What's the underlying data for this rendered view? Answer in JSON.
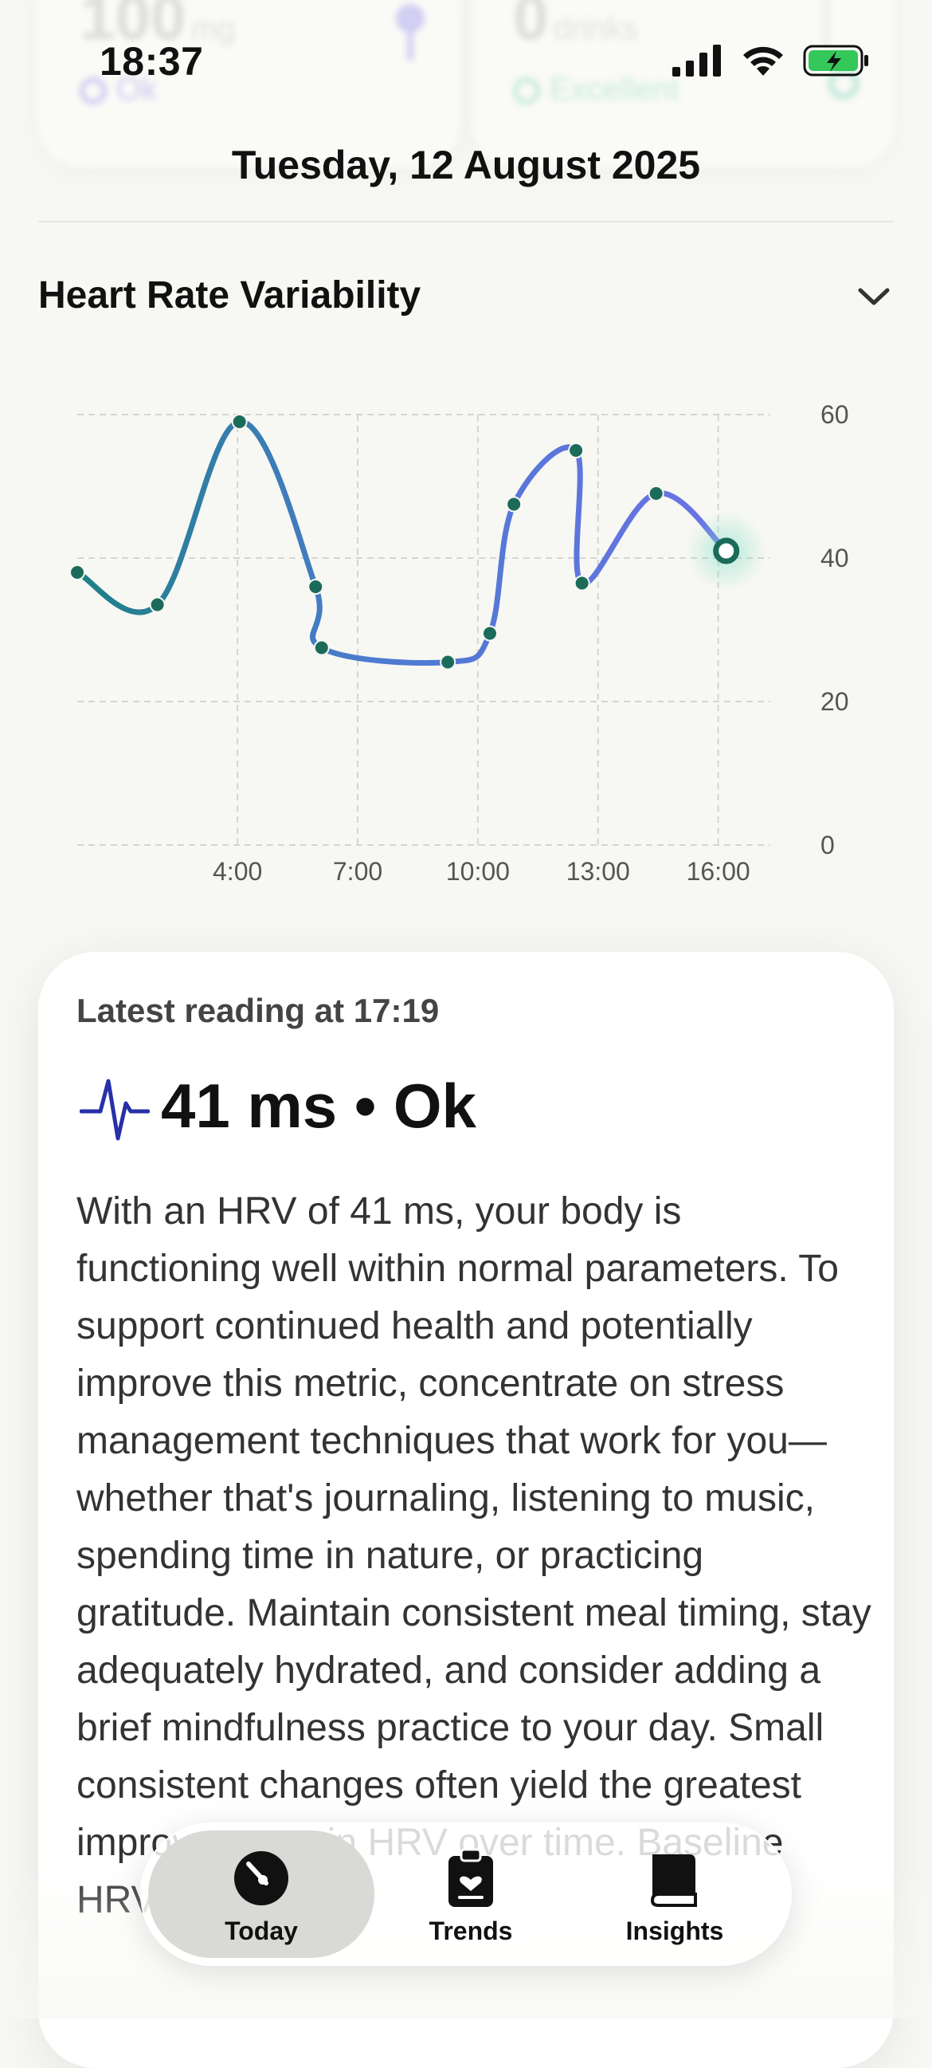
{
  "ghost_cards": [
    {
      "value": "100",
      "unit": "mg",
      "status": "Ok"
    },
    {
      "value": "0",
      "unit": "drinks",
      "status": "Excellent"
    }
  ],
  "status_bar": {
    "time": "18:37",
    "icons": [
      "cellular-signal-icon",
      "wifi-icon",
      "battery-charging-icon"
    ],
    "battery_color": "#34c759"
  },
  "header": {
    "date": "Tuesday, 12 August 2025"
  },
  "section": {
    "title": "Heart Rate Variability",
    "toggle_icon": "chevron-down-icon"
  },
  "chart_data": {
    "type": "line",
    "x_tick_labels": [
      "4:00",
      "7:00",
      "10:00",
      "13:00",
      "16:00"
    ],
    "x_ticks_hours": [
      4,
      7,
      10,
      13,
      16
    ],
    "xlim_hours": [
      0,
      17.3
    ],
    "ylim": [
      0,
      60
    ],
    "y_ticks": [
      0,
      20,
      40,
      60
    ],
    "grid": true,
    "y_axis_side": "right",
    "series": [
      {
        "points": [
          {
            "x": 0.0,
            "y": 38
          },
          {
            "x": 2.0,
            "y": 33.5
          },
          {
            "x": 4.05,
            "y": 59
          },
          {
            "x": 5.95,
            "y": 36
          },
          {
            "x": 6.1,
            "y": 27.5
          },
          {
            "x": 9.25,
            "y": 25.5
          },
          {
            "x": 10.3,
            "y": 29.5
          },
          {
            "x": 10.9,
            "y": 47.5
          },
          {
            "x": 12.45,
            "y": 55
          },
          {
            "x": 12.6,
            "y": 36.5
          },
          {
            "x": 14.45,
            "y": 49
          },
          {
            "x": 16.2,
            "y": 41
          }
        ]
      }
    ],
    "colors": {
      "start": "#1e7f86",
      "end": "#6a72e6",
      "point": "#1b6b5a",
      "latest_glow": "#7fe0c4"
    }
  },
  "reading": {
    "latest_label": "Latest reading at 17:19",
    "icon": "heart-pulse-icon",
    "value_text": "41 ms • Ok",
    "description": "With an HRV of 41 ms, your body is functioning well within normal parameters. To support continued health and potentially improve this metric, concentrate on stress management techniques that work for you—whether that's journaling, listening to music, spending time in nature, or practicing gratitude. Maintain consistent meal timing, stay adequately hydrated, and consider adding a brief mindfulness practice to your day. Small consistent changes often yield the greatest improvements in HRV over time. Baseline HRV is 40 ms."
  },
  "tabbar": {
    "tabs": [
      {
        "label": "Today",
        "icon": "gauge-icon",
        "active": true
      },
      {
        "label": "Trends",
        "icon": "clipboard-heart-icon",
        "active": false
      },
      {
        "label": "Insights",
        "icon": "book-icon",
        "active": false
      }
    ]
  }
}
